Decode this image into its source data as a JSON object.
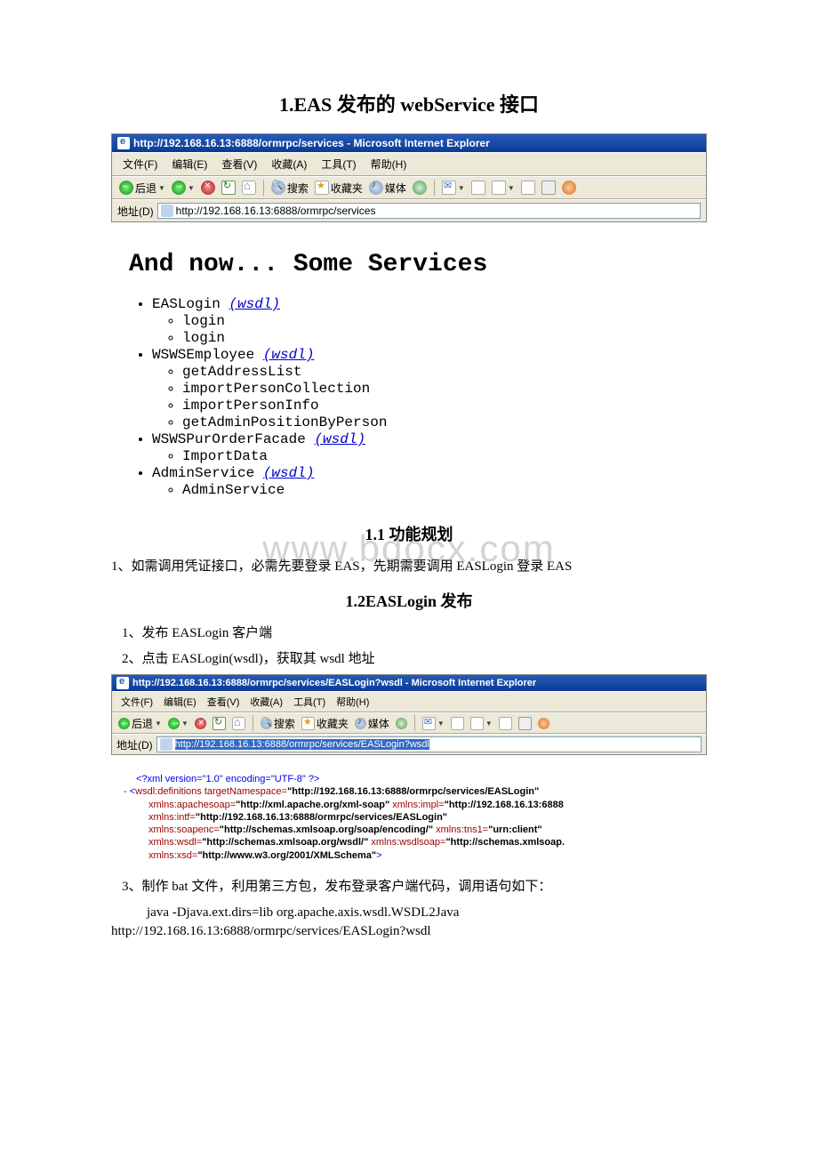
{
  "title": "1.EAS 发布的 webService 接口",
  "browser1": {
    "title": "http://192.168.16.13:6888/ormrpc/services - Microsoft Internet Explorer",
    "menu": {
      "file": "文件(F)",
      "edit": "编辑(E)",
      "view": "查看(V)",
      "fav": "收藏(A)",
      "tools": "工具(T)",
      "help": "帮助(H)"
    },
    "toolbar": {
      "back": "后退",
      "search": "搜索",
      "fav": "收藏夹",
      "media": "媒体"
    },
    "addr_label": "地址(D)",
    "url": "http://192.168.16.13:6888/ormrpc/services"
  },
  "services": {
    "heading": "And now... Some Services",
    "wsdl": "(wsdl)",
    "list": [
      {
        "name": "EASLogin",
        "methods": [
          "login",
          "login"
        ]
      },
      {
        "name": "WSWSEmployee",
        "methods": [
          "getAddressList",
          "importPersonCollection",
          "importPersonInfo",
          "getAdminPositionByPerson"
        ]
      },
      {
        "name": "WSWSPurOrderFacade",
        "methods": [
          "ImportData"
        ]
      },
      {
        "name": "AdminService",
        "methods": [
          "AdminService"
        ]
      }
    ]
  },
  "section11": {
    "heading": "1.1 功能规划",
    "watermark": "www.bdocx.com",
    "line1": "1、如需调用凭证接口，必需先要登录 EAS，先期需要调用 EASLogin 登录 EAS"
  },
  "section12": {
    "heading": "1.2EASLogin 发布",
    "line1": "1、发布 EASLogin 客户端",
    "line2": "2、点击 EASLogin(wsdl)，获取其 wsdl 地址"
  },
  "browser2": {
    "title": "http://192.168.16.13:6888/ormrpc/services/EASLogin?wsdl - Microsoft Internet Explorer",
    "menu": {
      "file": "文件(F)",
      "edit": "编辑(E)",
      "view": "查看(V)",
      "fav": "收藏(A)",
      "tools": "工具(T)",
      "help": "帮助(H)"
    },
    "toolbar": {
      "back": "后退",
      "search": "搜索",
      "fav": "收藏夹",
      "media": "媒体"
    },
    "addr_label": "地址(D)",
    "url": "http://192.168.16.13:6888/ormrpc/services/EASLogin?wsdl"
  },
  "xml": {
    "decl": "<?xml version=\"1.0\" encoding=\"UTF-8\" ?>",
    "defs_open": "<wsdl:definitions",
    "tn_attr": "targetNamespace=",
    "tn_val": "\"http://192.168.16.13:6888/ormrpc/services/EASLogin\"",
    "ns_apache_attr": "xmlns:apachesoap=",
    "ns_apache_val": "\"http://xml.apache.org/xml-soap\"",
    "ns_impl_attr": "xmlns:impl=",
    "ns_impl_val": "\"http://192.168.16.13:6888",
    "ns_intf_attr": "xmlns:intf=",
    "ns_intf_val": "\"http://192.168.16.13:6888/ormrpc/services/EASLogin\"",
    "ns_soapenc_attr": "xmlns:soapenc=",
    "ns_soapenc_val": "\"http://schemas.xmlsoap.org/soap/encoding/\"",
    "ns_tns1_attr": "xmlns:tns1=",
    "ns_tns1_val": "\"urn:client\"",
    "ns_wsdl_attr": "xmlns:wsdl=",
    "ns_wsdl_val": "\"http://schemas.xmlsoap.org/wsdl/\"",
    "ns_wsdlsoap_attr": "xmlns:wsdlsoap=",
    "ns_wsdlsoap_val": "\"http://schemas.xmlsoap.",
    "ns_xsd_attr": "xmlns:xsd=",
    "ns_xsd_val": "\"http://www.w3.org/2001/XMLSchema\"",
    "close": ">"
  },
  "section3": {
    "line": "3、制作 bat 文件，利用第三方包，发布登录客户端代码，调用语句如下：",
    "code1": "java -Djava.ext.dirs=lib org.apache.axis.wsdl.WSDL2Java",
    "code2": "http://192.168.16.13:6888/ormrpc/services/EASLogin?wsdl"
  }
}
